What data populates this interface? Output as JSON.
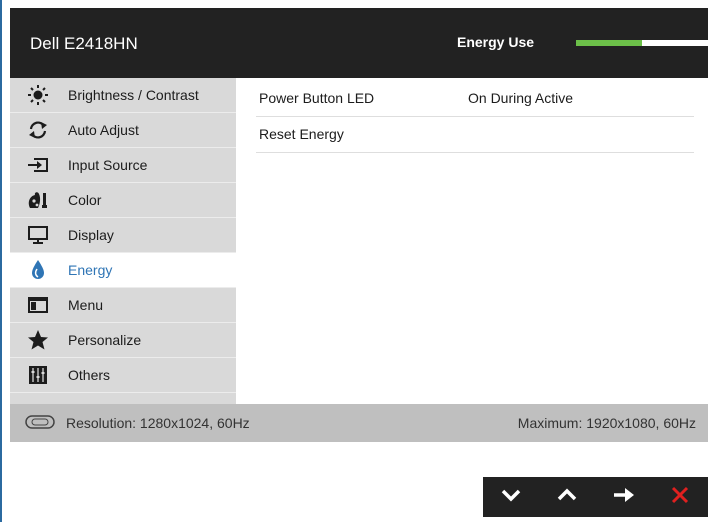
{
  "header": {
    "model": "Dell E2418HN",
    "energy_label": "Energy Use",
    "energy_level": 0.5
  },
  "sidebar": {
    "items": [
      {
        "label": "Brightness / Contrast",
        "icon": "sun-icon"
      },
      {
        "label": "Auto Adjust",
        "icon": "auto-adjust-icon"
      },
      {
        "label": "Input Source",
        "icon": "input-source-icon"
      },
      {
        "label": "Color",
        "icon": "color-icon"
      },
      {
        "label": "Display",
        "icon": "monitor-icon"
      },
      {
        "label": "Energy",
        "icon": "energy-drop-icon",
        "active": true
      },
      {
        "label": "Menu",
        "icon": "menu-icon"
      },
      {
        "label": "Personalize",
        "icon": "star-icon"
      },
      {
        "label": "Others",
        "icon": "sliders-icon"
      }
    ]
  },
  "content": {
    "rows": [
      {
        "key": "Power Button LED",
        "value": "On During Active"
      },
      {
        "key": "Reset Energy",
        "value": ""
      }
    ]
  },
  "status": {
    "resolution": "Resolution: 1280x1024, 60Hz",
    "maximum": "Maximum: 1920x1080, 60Hz"
  },
  "colors": {
    "accent": "#2f75b5",
    "energy_fill": "#6cc049",
    "close": "#e0201f"
  }
}
